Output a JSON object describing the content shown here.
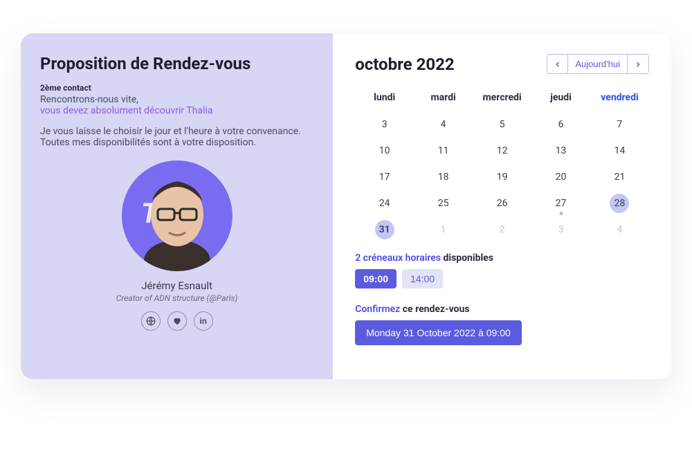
{
  "left": {
    "title": "Proposition de Rendez-vous",
    "subhead": "2ème contact",
    "intro1": "Rencontrons-nous vite,",
    "intro2": "vous devez absolument découvrir Thalia",
    "body1": "Je vous laisse le choisir le jour et l'heure à votre convenance.",
    "body2": "Toutes mes disponibilités sont à votre disposition.",
    "author_name": "Jérémy Esnault",
    "author_role": "Creator of ADN structure (@Paris)"
  },
  "calendar": {
    "month_label": "octobre 2022",
    "today_label": "Aujourd'hui",
    "dow": [
      "lundi",
      "mardi",
      "mercredi",
      "jeudi",
      "vendredi"
    ],
    "accent_dow_index": 4,
    "weeks": [
      [
        {
          "n": 3
        },
        {
          "n": 4
        },
        {
          "n": 5
        },
        {
          "n": 6
        },
        {
          "n": 7
        }
      ],
      [
        {
          "n": 10
        },
        {
          "n": 11
        },
        {
          "n": 12
        },
        {
          "n": 13
        },
        {
          "n": 14
        }
      ],
      [
        {
          "n": 17
        },
        {
          "n": 18
        },
        {
          "n": 19
        },
        {
          "n": 20
        },
        {
          "n": 21
        }
      ],
      [
        {
          "n": 24
        },
        {
          "n": 25
        },
        {
          "n": 26
        },
        {
          "n": 27,
          "dot": true
        },
        {
          "n": 28,
          "highlight": true
        }
      ],
      [
        {
          "n": 31,
          "selected": true
        },
        {
          "n": 1,
          "muted": true
        },
        {
          "n": 2,
          "muted": true
        },
        {
          "n": 3,
          "muted": true
        },
        {
          "n": 4,
          "muted": true
        }
      ]
    ]
  },
  "slots": {
    "count_prefix": "2 créneaux horaires",
    "label_suffix": "disponibles",
    "items": [
      {
        "time": "09:00",
        "active": true
      },
      {
        "time": "14:00",
        "active": false
      }
    ]
  },
  "confirm": {
    "prefix": "Confirmez",
    "suffix": "ce rendez-vous",
    "button": "Monday 31 October 2022 à 09:00"
  }
}
